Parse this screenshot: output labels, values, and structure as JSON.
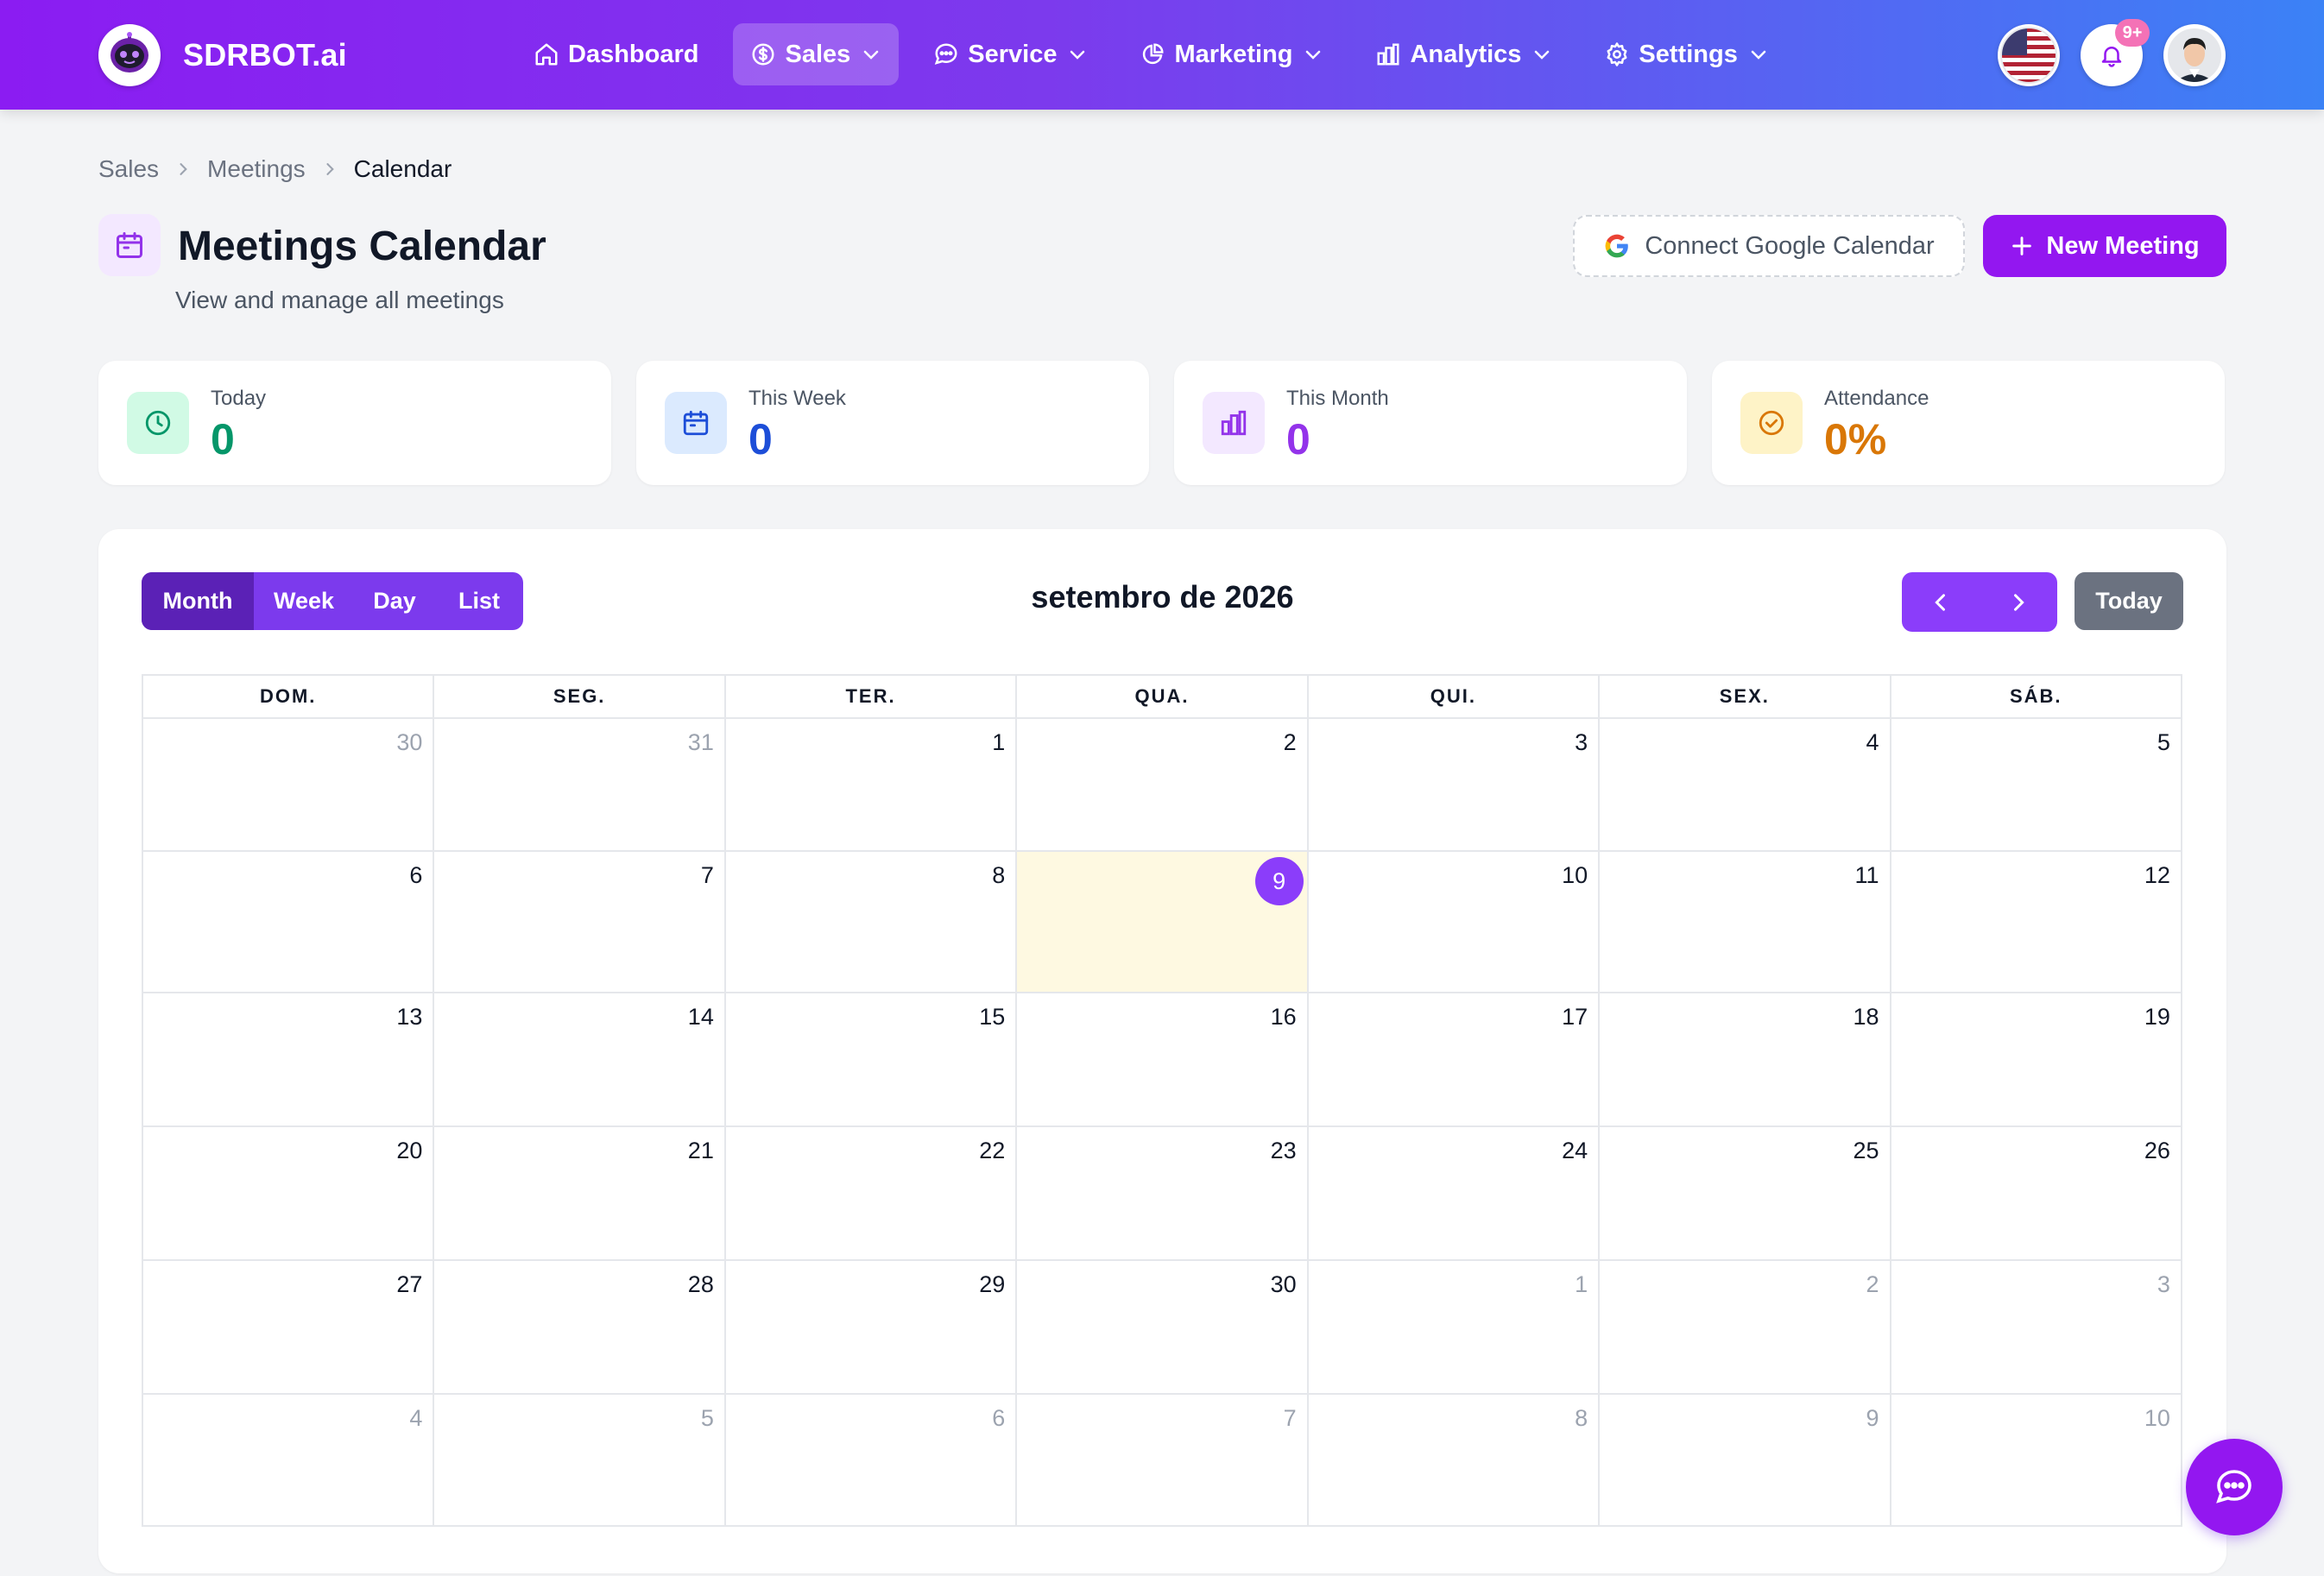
{
  "brand": {
    "name": "SDRBOT.ai"
  },
  "nav": {
    "items": [
      {
        "label": "Dashboard",
        "icon": "home-icon",
        "dropdown": false,
        "active": false
      },
      {
        "label": "Sales",
        "icon": "dollar-circle-icon",
        "dropdown": true,
        "active": true
      },
      {
        "label": "Service",
        "icon": "chat-bubble-icon",
        "dropdown": true,
        "active": false
      },
      {
        "label": "Marketing",
        "icon": "pie-chart-icon",
        "dropdown": true,
        "active": false
      },
      {
        "label": "Analytics",
        "icon": "bar-chart-icon",
        "dropdown": true,
        "active": false
      },
      {
        "label": "Settings",
        "icon": "gear-icon",
        "dropdown": true,
        "active": false
      }
    ],
    "notifications_badge": "9+"
  },
  "breadcrumb": [
    "Sales",
    "Meetings",
    "Calendar"
  ],
  "header": {
    "title": "Meetings Calendar",
    "subtitle": "View and manage all meetings",
    "connect_google_label": "Connect Google Calendar",
    "new_meeting_label": "New Meeting"
  },
  "stats": [
    {
      "label": "Today",
      "value": "0",
      "color": "#059669",
      "bg": "#d1fae5",
      "icon": "clock-icon"
    },
    {
      "label": "This Week",
      "value": "0",
      "color": "#1d4ed8",
      "bg": "#dbeafe",
      "icon": "calendar-icon"
    },
    {
      "label": "This Month",
      "value": "0",
      "color": "#9333ea",
      "bg": "#f3e8ff",
      "icon": "bar-chart-icon"
    },
    {
      "label": "Attendance",
      "value": "0%",
      "color": "#d97706",
      "bg": "#fef3c7",
      "icon": "check-circle-icon"
    }
  ],
  "calendar": {
    "views": [
      "Month",
      "Week",
      "Day",
      "List"
    ],
    "active_view": "Month",
    "title": "setembro de 2026",
    "today_label": "Today",
    "weekdays": [
      "DOM.",
      "SEG.",
      "TER.",
      "QUA.",
      "QUI.",
      "SEX.",
      "SÁB."
    ],
    "weeks": [
      [
        {
          "d": "30",
          "other": true
        },
        {
          "d": "31",
          "other": true
        },
        {
          "d": "1"
        },
        {
          "d": "2"
        },
        {
          "d": "3"
        },
        {
          "d": "4"
        },
        {
          "d": "5"
        }
      ],
      [
        {
          "d": "6"
        },
        {
          "d": "7"
        },
        {
          "d": "8"
        },
        {
          "d": "9",
          "today": true
        },
        {
          "d": "10"
        },
        {
          "d": "11"
        },
        {
          "d": "12"
        }
      ],
      [
        {
          "d": "13"
        },
        {
          "d": "14"
        },
        {
          "d": "15"
        },
        {
          "d": "16"
        },
        {
          "d": "17"
        },
        {
          "d": "18"
        },
        {
          "d": "19"
        }
      ],
      [
        {
          "d": "20"
        },
        {
          "d": "21"
        },
        {
          "d": "22"
        },
        {
          "d": "23"
        },
        {
          "d": "24"
        },
        {
          "d": "25"
        },
        {
          "d": "26"
        }
      ],
      [
        {
          "d": "27"
        },
        {
          "d": "28"
        },
        {
          "d": "29"
        },
        {
          "d": "30"
        },
        {
          "d": "1",
          "other": true
        },
        {
          "d": "2",
          "other": true
        },
        {
          "d": "3",
          "other": true
        }
      ],
      [
        {
          "d": "4",
          "other": true
        },
        {
          "d": "5",
          "other": true
        },
        {
          "d": "6",
          "other": true
        },
        {
          "d": "7",
          "other": true
        },
        {
          "d": "8",
          "other": true
        },
        {
          "d": "9",
          "other": true
        },
        {
          "d": "10",
          "other": true
        }
      ]
    ]
  },
  "colors": {
    "accent": "#9317f0",
    "today_highlight": "#fef9e1"
  }
}
